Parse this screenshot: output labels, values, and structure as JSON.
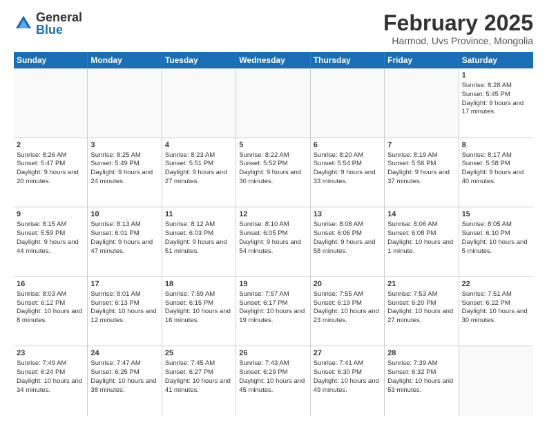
{
  "logo": {
    "general": "General",
    "blue": "Blue"
  },
  "title": "February 2025",
  "location": "Harmod, Uvs Province, Mongolia",
  "header_days": [
    "Sunday",
    "Monday",
    "Tuesday",
    "Wednesday",
    "Thursday",
    "Friday",
    "Saturday"
  ],
  "weeks": [
    [
      {
        "day": "",
        "content": "",
        "empty": true
      },
      {
        "day": "",
        "content": "",
        "empty": true
      },
      {
        "day": "",
        "content": "",
        "empty": true
      },
      {
        "day": "",
        "content": "",
        "empty": true
      },
      {
        "day": "",
        "content": "",
        "empty": true
      },
      {
        "day": "",
        "content": "",
        "empty": true
      },
      {
        "day": "1",
        "content": "Sunrise: 8:28 AM\nSunset: 5:45 PM\nDaylight: 9 hours and 17 minutes.",
        "empty": false
      }
    ],
    [
      {
        "day": "2",
        "content": "Sunrise: 8:26 AM\nSunset: 5:47 PM\nDaylight: 9 hours and 20 minutes.",
        "empty": false
      },
      {
        "day": "3",
        "content": "Sunrise: 8:25 AM\nSunset: 5:49 PM\nDaylight: 9 hours and 24 minutes.",
        "empty": false
      },
      {
        "day": "4",
        "content": "Sunrise: 8:23 AM\nSunset: 5:51 PM\nDaylight: 9 hours and 27 minutes.",
        "empty": false
      },
      {
        "day": "5",
        "content": "Sunrise: 8:22 AM\nSunset: 5:52 PM\nDaylight: 9 hours and 30 minutes.",
        "empty": false
      },
      {
        "day": "6",
        "content": "Sunrise: 8:20 AM\nSunset: 5:54 PM\nDaylight: 9 hours and 33 minutes.",
        "empty": false
      },
      {
        "day": "7",
        "content": "Sunrise: 8:19 AM\nSunset: 5:56 PM\nDaylight: 9 hours and 37 minutes.",
        "empty": false
      },
      {
        "day": "8",
        "content": "Sunrise: 8:17 AM\nSunset: 5:58 PM\nDaylight: 9 hours and 40 minutes.",
        "empty": false
      }
    ],
    [
      {
        "day": "9",
        "content": "Sunrise: 8:15 AM\nSunset: 5:59 PM\nDaylight: 9 hours and 44 minutes.",
        "empty": false
      },
      {
        "day": "10",
        "content": "Sunrise: 8:13 AM\nSunset: 6:01 PM\nDaylight: 9 hours and 47 minutes.",
        "empty": false
      },
      {
        "day": "11",
        "content": "Sunrise: 8:12 AM\nSunset: 6:03 PM\nDaylight: 9 hours and 51 minutes.",
        "empty": false
      },
      {
        "day": "12",
        "content": "Sunrise: 8:10 AM\nSunset: 6:05 PM\nDaylight: 9 hours and 54 minutes.",
        "empty": false
      },
      {
        "day": "13",
        "content": "Sunrise: 8:08 AM\nSunset: 6:06 PM\nDaylight: 9 hours and 58 minutes.",
        "empty": false
      },
      {
        "day": "14",
        "content": "Sunrise: 8:06 AM\nSunset: 6:08 PM\nDaylight: 10 hours and 1 minute.",
        "empty": false
      },
      {
        "day": "15",
        "content": "Sunrise: 8:05 AM\nSunset: 6:10 PM\nDaylight: 10 hours and 5 minutes.",
        "empty": false
      }
    ],
    [
      {
        "day": "16",
        "content": "Sunrise: 8:03 AM\nSunset: 6:12 PM\nDaylight: 10 hours and 8 minutes.",
        "empty": false
      },
      {
        "day": "17",
        "content": "Sunrise: 8:01 AM\nSunset: 6:13 PM\nDaylight: 10 hours and 12 minutes.",
        "empty": false
      },
      {
        "day": "18",
        "content": "Sunrise: 7:59 AM\nSunset: 6:15 PM\nDaylight: 10 hours and 16 minutes.",
        "empty": false
      },
      {
        "day": "19",
        "content": "Sunrise: 7:57 AM\nSunset: 6:17 PM\nDaylight: 10 hours and 19 minutes.",
        "empty": false
      },
      {
        "day": "20",
        "content": "Sunrise: 7:55 AM\nSunset: 6:19 PM\nDaylight: 10 hours and 23 minutes.",
        "empty": false
      },
      {
        "day": "21",
        "content": "Sunrise: 7:53 AM\nSunset: 6:20 PM\nDaylight: 10 hours and 27 minutes.",
        "empty": false
      },
      {
        "day": "22",
        "content": "Sunrise: 7:51 AM\nSunset: 6:22 PM\nDaylight: 10 hours and 30 minutes.",
        "empty": false
      }
    ],
    [
      {
        "day": "23",
        "content": "Sunrise: 7:49 AM\nSunset: 6:24 PM\nDaylight: 10 hours and 34 minutes.",
        "empty": false
      },
      {
        "day": "24",
        "content": "Sunrise: 7:47 AM\nSunset: 6:25 PM\nDaylight: 10 hours and 38 minutes.",
        "empty": false
      },
      {
        "day": "25",
        "content": "Sunrise: 7:45 AM\nSunset: 6:27 PM\nDaylight: 10 hours and 41 minutes.",
        "empty": false
      },
      {
        "day": "26",
        "content": "Sunrise: 7:43 AM\nSunset: 6:29 PM\nDaylight: 10 hours and 45 minutes.",
        "empty": false
      },
      {
        "day": "27",
        "content": "Sunrise: 7:41 AM\nSunset: 6:30 PM\nDaylight: 10 hours and 49 minutes.",
        "empty": false
      },
      {
        "day": "28",
        "content": "Sunrise: 7:39 AM\nSunset: 6:32 PM\nDaylight: 10 hours and 53 minutes.",
        "empty": false
      },
      {
        "day": "",
        "content": "",
        "empty": true
      }
    ]
  ]
}
